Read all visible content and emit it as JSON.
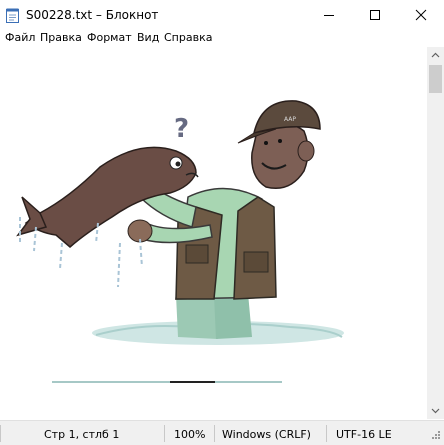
{
  "window": {
    "title": "S00228.txt – Блокнот",
    "icon": "notepad-icon",
    "controls": [
      "minimize-icon",
      "maximize-icon",
      "close-icon"
    ]
  },
  "menu": {
    "items": [
      {
        "label": "Файл"
      },
      {
        "label": "Правка"
      },
      {
        "label": "Формат"
      },
      {
        "label": "Вид"
      },
      {
        "label": "Справка"
      }
    ]
  },
  "document": {
    "image": "cartoon man in fishing vest holding a large fish, with a question mark above the fish"
  },
  "scrollbar": {
    "icons": [
      "scroll-up-icon",
      "scroll-down-icon"
    ]
  },
  "status": {
    "position": "Стр 1, стлб 1",
    "zoom": "100%",
    "line_endings": "Windows (CRLF)",
    "encoding": "UTF-16 LE"
  }
}
